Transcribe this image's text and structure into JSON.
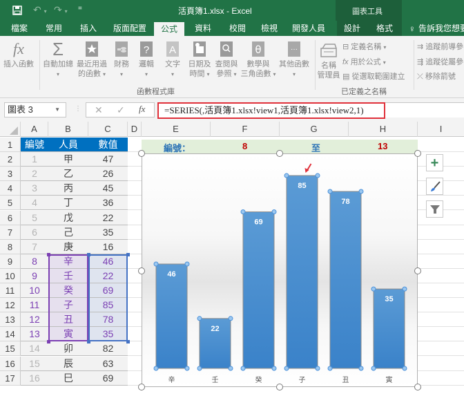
{
  "window": {
    "title": "活頁簿1.xlsx - Excel",
    "context_tab_group": "圖表工具",
    "quick_access": {
      "save": "save-icon",
      "undo": "undo-icon",
      "redo": "redo-icon",
      "customize": "customize-qat-icon"
    }
  },
  "tabs": [
    {
      "label": "檔案",
      "active": false
    },
    {
      "label": "常用",
      "active": false
    },
    {
      "label": "插入",
      "active": false
    },
    {
      "label": "版面配置",
      "active": false
    },
    {
      "label": "公式",
      "active": true
    },
    {
      "label": "資料",
      "active": false
    },
    {
      "label": "校閱",
      "active": false
    },
    {
      "label": "檢視",
      "active": false
    },
    {
      "label": "開發人員",
      "active": false
    },
    {
      "label": "設計",
      "active": false
    },
    {
      "label": "格式",
      "active": false
    }
  ],
  "tell_me": "告訴我您想要",
  "ribbon": {
    "function_library": {
      "group_label": "函數程式庫",
      "insert_function": "插入函數",
      "autosum": "自動加總",
      "recent_line1": "最近用過",
      "recent_line2": "的函數",
      "financial": "財務",
      "logical": "邏輯",
      "text": "文字",
      "datetime_line1": "日期及",
      "datetime_line2": "時間",
      "lookup_line1": "查閱與",
      "lookup_line2": "參照",
      "math_line1": "數學與",
      "math_line2": "三角函數",
      "more": "其他函數"
    },
    "defined_names": {
      "group_label": "已定義之名稱",
      "name_manager_line1": "名稱",
      "name_manager_line2": "管理員",
      "define_name": "定義名稱",
      "use_in_formula": "用於公式",
      "create_from_selection": "從選取範圍建立"
    },
    "formula_auditing": {
      "trace_precedents": "追蹤前導參",
      "trace_dependents": "追蹤從屬參",
      "remove_arrows": "移除箭號"
    }
  },
  "formula_bar": {
    "name_box": "圖表 3",
    "cancel": "✕",
    "enter": "✓",
    "fx": "fx",
    "formula": "=SERIES(,活頁簿1.xlsx!view1,活頁簿1.xlsx!view2,1)"
  },
  "columns": [
    "A",
    "B",
    "C",
    "D",
    "E",
    "F",
    "G",
    "H",
    "I"
  ],
  "rows": [
    "1",
    "2",
    "3",
    "4",
    "5",
    "6",
    "7",
    "8",
    "9",
    "10",
    "11",
    "12",
    "13",
    "14",
    "15",
    "16",
    "17"
  ],
  "table": {
    "headers": [
      "編號",
      "人員",
      "數值"
    ],
    "data": [
      [
        "1",
        "甲",
        "47"
      ],
      [
        "2",
        "乙",
        "26"
      ],
      [
        "3",
        "丙",
        "45"
      ],
      [
        "4",
        "丁",
        "36"
      ],
      [
        "5",
        "戊",
        "22"
      ],
      [
        "6",
        "己",
        "35"
      ],
      [
        "7",
        "庚",
        "16"
      ],
      [
        "8",
        "辛",
        "46"
      ],
      [
        "9",
        "壬",
        "22"
      ],
      [
        "10",
        "癸",
        "69"
      ],
      [
        "11",
        "子",
        "85"
      ],
      [
        "12",
        "丑",
        "78"
      ],
      [
        "13",
        "寅",
        "35"
      ],
      [
        "14",
        "卯",
        "82"
      ],
      [
        "15",
        "辰",
        "63"
      ],
      [
        "16",
        "巳",
        "69"
      ]
    ],
    "selected_from": 8,
    "selected_to": 13
  },
  "range_bar": {
    "label": "編號：",
    "from": "8",
    "to_label": "至",
    "to": "13"
  },
  "colors": {
    "excel_green": "#217346",
    "header_blue": "#0070c0",
    "bar_blue": "#4a8fd4",
    "selection_purple": "#7b3fb3",
    "selection_blue": "#4472c4",
    "red_value": "#c00000",
    "range_bar_bg": "#e2efda"
  },
  "chart_side_buttons": [
    "chart-elements-icon",
    "chart-styles-icon",
    "chart-filters-icon"
  ],
  "chart_data": {
    "type": "bar",
    "title": "",
    "categories": [
      "辛",
      "壬",
      "癸",
      "子",
      "丑",
      "寅"
    ],
    "values": [
      46,
      22,
      69,
      85,
      78,
      35
    ],
    "xlabel": "",
    "ylabel": "",
    "ylim": [
      0,
      85
    ],
    "grid": false,
    "legend": "none",
    "data_labels": true,
    "annotation": "red arrow pointing at the maximum bar (子, 85)"
  }
}
